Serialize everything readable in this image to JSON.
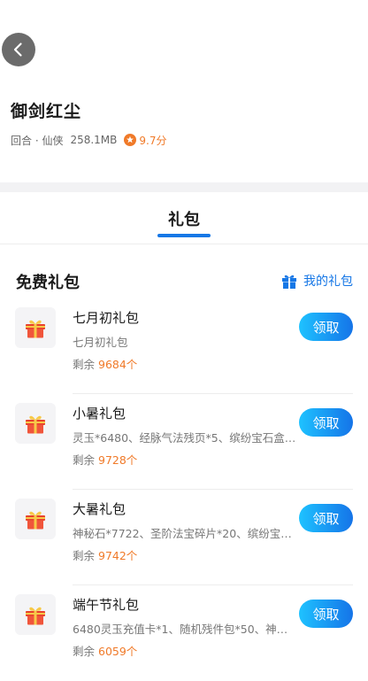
{
  "header": {
    "back_icon": "chevron-left-icon",
    "game_title": "御剑红尘",
    "genre": "回合 · 仙侠",
    "size": "258.1MB",
    "rating": "9.7分"
  },
  "tabs": [
    {
      "label": "礼包",
      "active": true
    }
  ],
  "section": {
    "title": "免费礼包",
    "my_gifts_label": "我的礼包",
    "my_gifts_icon": "gift-icon"
  },
  "gifts": [
    {
      "name": "七月初礼包",
      "desc": "七月初礼包",
      "remain_label": "剩余",
      "remain_count": "9684个",
      "button": "领取"
    },
    {
      "name": "小暑礼包",
      "desc": "灵玉*6480、经脉气法残页*5、缤纷宝石盒*...",
      "remain_label": "剩余",
      "remain_count": "9728个",
      "button": "领取"
    },
    {
      "name": "大暑礼包",
      "desc": "神秘石*7722、圣阶法宝碎片*20、缤纷宝石...",
      "remain_label": "剩余",
      "remain_count": "9742个",
      "button": "领取"
    },
    {
      "name": "端午节礼包",
      "desc": "6480灵玉充值卡*1、随机残件包*50、神兽...",
      "remain_label": "剩余",
      "remain_count": "6059个",
      "button": "领取"
    }
  ],
  "colors": {
    "accent": "#1677e6",
    "highlight": "#f07a29",
    "gift_red": "#e8412c",
    "gift_gold": "#f7c948"
  }
}
